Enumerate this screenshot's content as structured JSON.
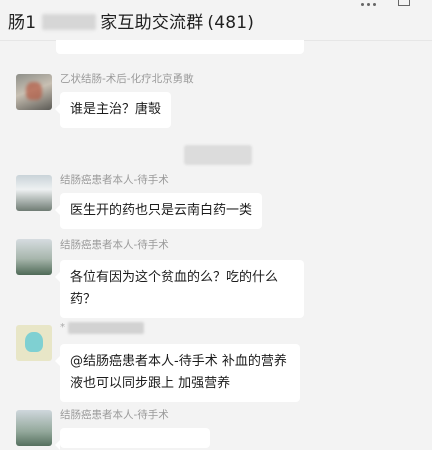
{
  "header": {
    "title_prefix": "肠1",
    "title_suffix": "家互助交流群",
    "member_count": "(481)"
  },
  "messages": [
    {
      "sender": "乙状结肠-术后-化疗北京勇敢",
      "text": "谁是主治？唐彀"
    },
    {
      "sender": "结肠癌患者本人-待手术",
      "text": "医生开的药也只是云南白药一类"
    },
    {
      "sender": "结肠癌患者本人-待手术",
      "text": "各位有因为这个贫血的么？吃的什么药？"
    },
    {
      "sender": "*",
      "text": "@结肠癌患者本人-待手术 补血的营养液也可以同步跟上 加强营养"
    },
    {
      "sender": "结肠癌患者本人-待手术",
      "text": ""
    }
  ]
}
